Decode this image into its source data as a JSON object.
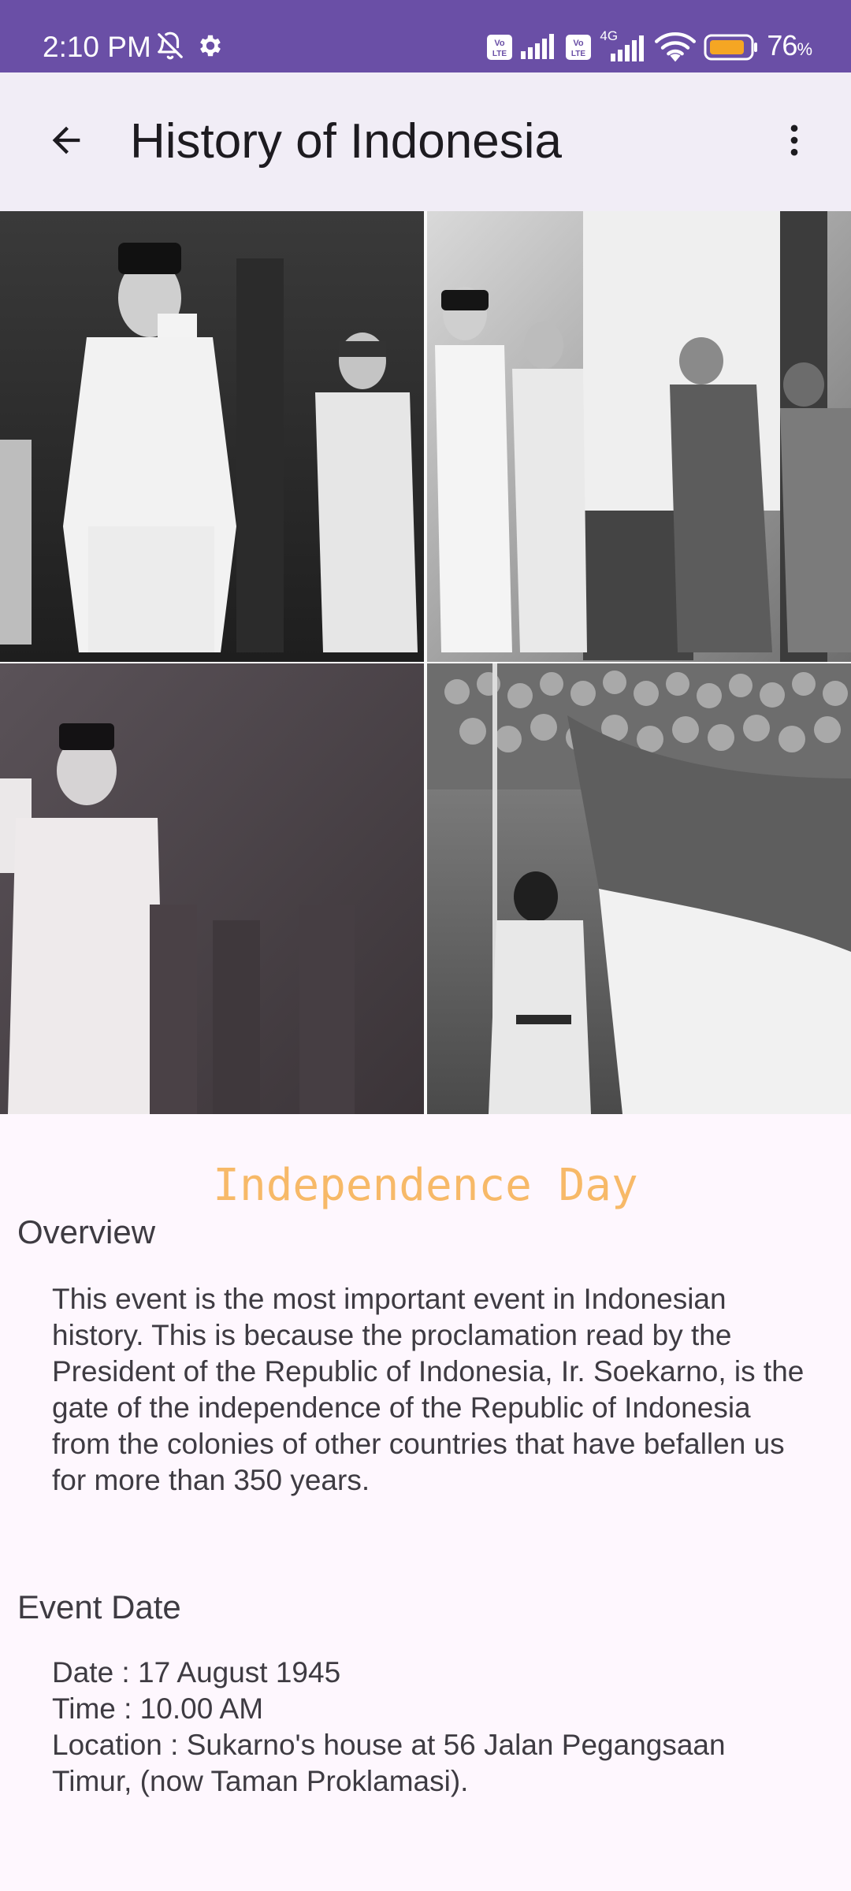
{
  "status_bar": {
    "time": "2:10 PM",
    "battery_percent": "76",
    "battery_unit": "%",
    "network_label": "4G",
    "volte_label": "Vo LTE",
    "colors": {
      "background": "#6A4FA6",
      "battery_fill": "#F5A623"
    }
  },
  "app_bar": {
    "title": "History of Indonesia",
    "back_icon": "arrow-back-icon",
    "menu_icon": "more-vert-icon"
  },
  "hero": {
    "photos": [
      "photo-proclamation-reading",
      "photo-flag-ceremony",
      "photo-speech",
      "photo-flag-raising-crowd"
    ]
  },
  "event": {
    "title": "Independence Day",
    "title_color": "#F7B968",
    "overview": {
      "heading": "Overview",
      "body": "This event is the most important event in Indonesian history. This is because the proclamation read by the President of the Republic of Indonesia, Ir. Soekarno, is the gate of the independence of the Republic of Indonesia from the colonies of other countries that have befallen us for more than 350 years."
    },
    "event_date": {
      "heading": "Event Date",
      "body": "Date : 17 August 1945\n Time : 10.00 AM\n Location : Sukarno's house at 56 Jalan Pegangsaan Timur, (now Taman Proklamasi)."
    }
  }
}
